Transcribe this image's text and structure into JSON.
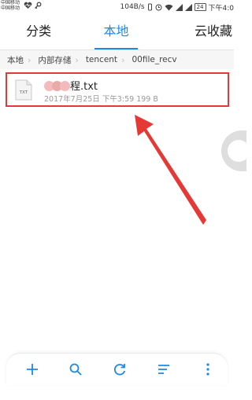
{
  "status_bar": {
    "carrier_1": "中国移动",
    "carrier_2": "中国移动",
    "net_speed": "104B/s",
    "battery": "24",
    "time": "下午4:0"
  },
  "tabs": [
    {
      "label": "分类",
      "active": false
    },
    {
      "label": "本地",
      "active": true
    },
    {
      "label": "云收藏",
      "active": false
    }
  ],
  "breadcrumb": [
    "本地",
    "内部存储",
    "tencent",
    "00file_recv"
  ],
  "files": [
    {
      "name": "程.txt",
      "icon_text": "TXT",
      "date": "2017年7月25日",
      "time": "下午3:59",
      "size": "199 B"
    }
  ],
  "toolbar": [
    "add-icon",
    "search-icon",
    "refresh-icon",
    "sort-icon",
    "more-icon"
  ],
  "colors": {
    "accent": "#1e88e5",
    "highlight": "#e53935"
  }
}
